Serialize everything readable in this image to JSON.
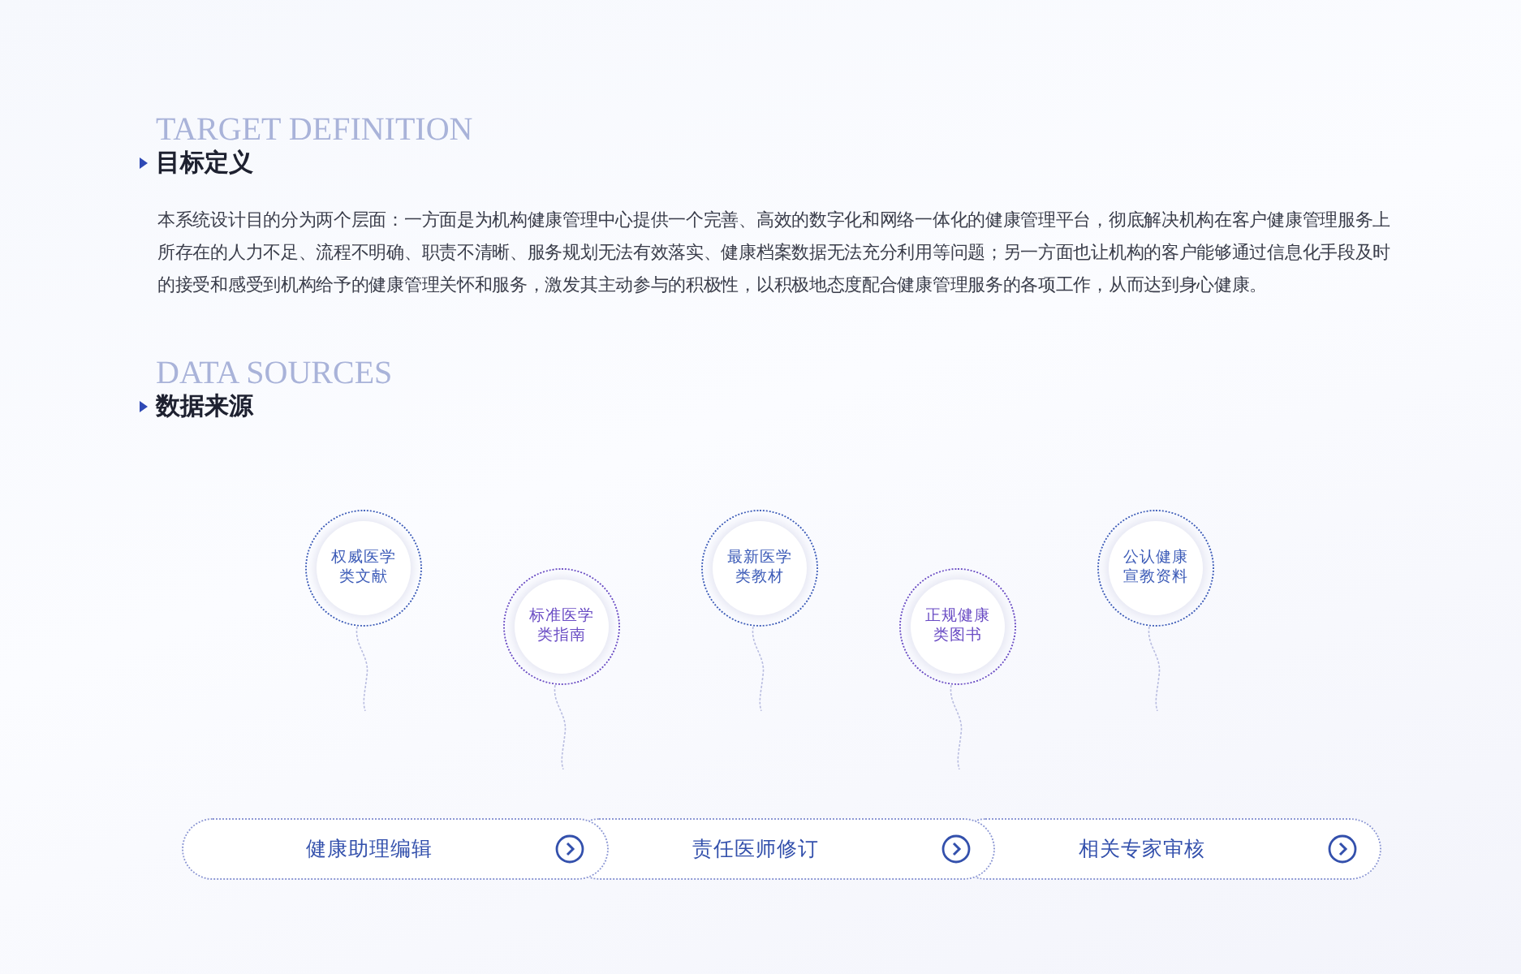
{
  "sections": [
    {
      "ghost": "TARGET DEFINITION",
      "title": "目标定义",
      "paragraph": "本系统设计目的分为两个层面：一方面是为机构健康管理中心提供一个完善、高效的数字化和网络一体化的健康管理平台，彻底解决机构在客户健康管理服务上所存在的人力不足、流程不明确、职责不清晰、服务规划无法有效落实、健康档案数据无法充分利用等问题；另一方面也让机构的客户能够通过信息化手段及时的接受和感受到机构给予的健康管理关怀和服务，激发其主动参与的积极性，以积极地态度配合健康管理服务的各项工作，从而达到身心健康。"
    },
    {
      "ghost": "DATA SOURCES",
      "title": "数据来源"
    }
  ],
  "sources": [
    {
      "lines": [
        "权威医学",
        "类文献"
      ],
      "color": "#3d5cb8"
    },
    {
      "lines": [
        "标准医学",
        "类指南"
      ],
      "color": "#6a4cc4"
    },
    {
      "lines": [
        "最新医学",
        "类教材"
      ],
      "color": "#3d5cb8"
    },
    {
      "lines": [
        "正规健康",
        "类图书"
      ],
      "color": "#6a4cc4"
    },
    {
      "lines": [
        "公认健康",
        "宣教资料"
      ],
      "color": "#3d5cb8"
    }
  ],
  "steps": [
    {
      "label": "健康助理编辑"
    },
    {
      "label": "责任医师修订"
    },
    {
      "label": "相关专家审核"
    }
  ]
}
